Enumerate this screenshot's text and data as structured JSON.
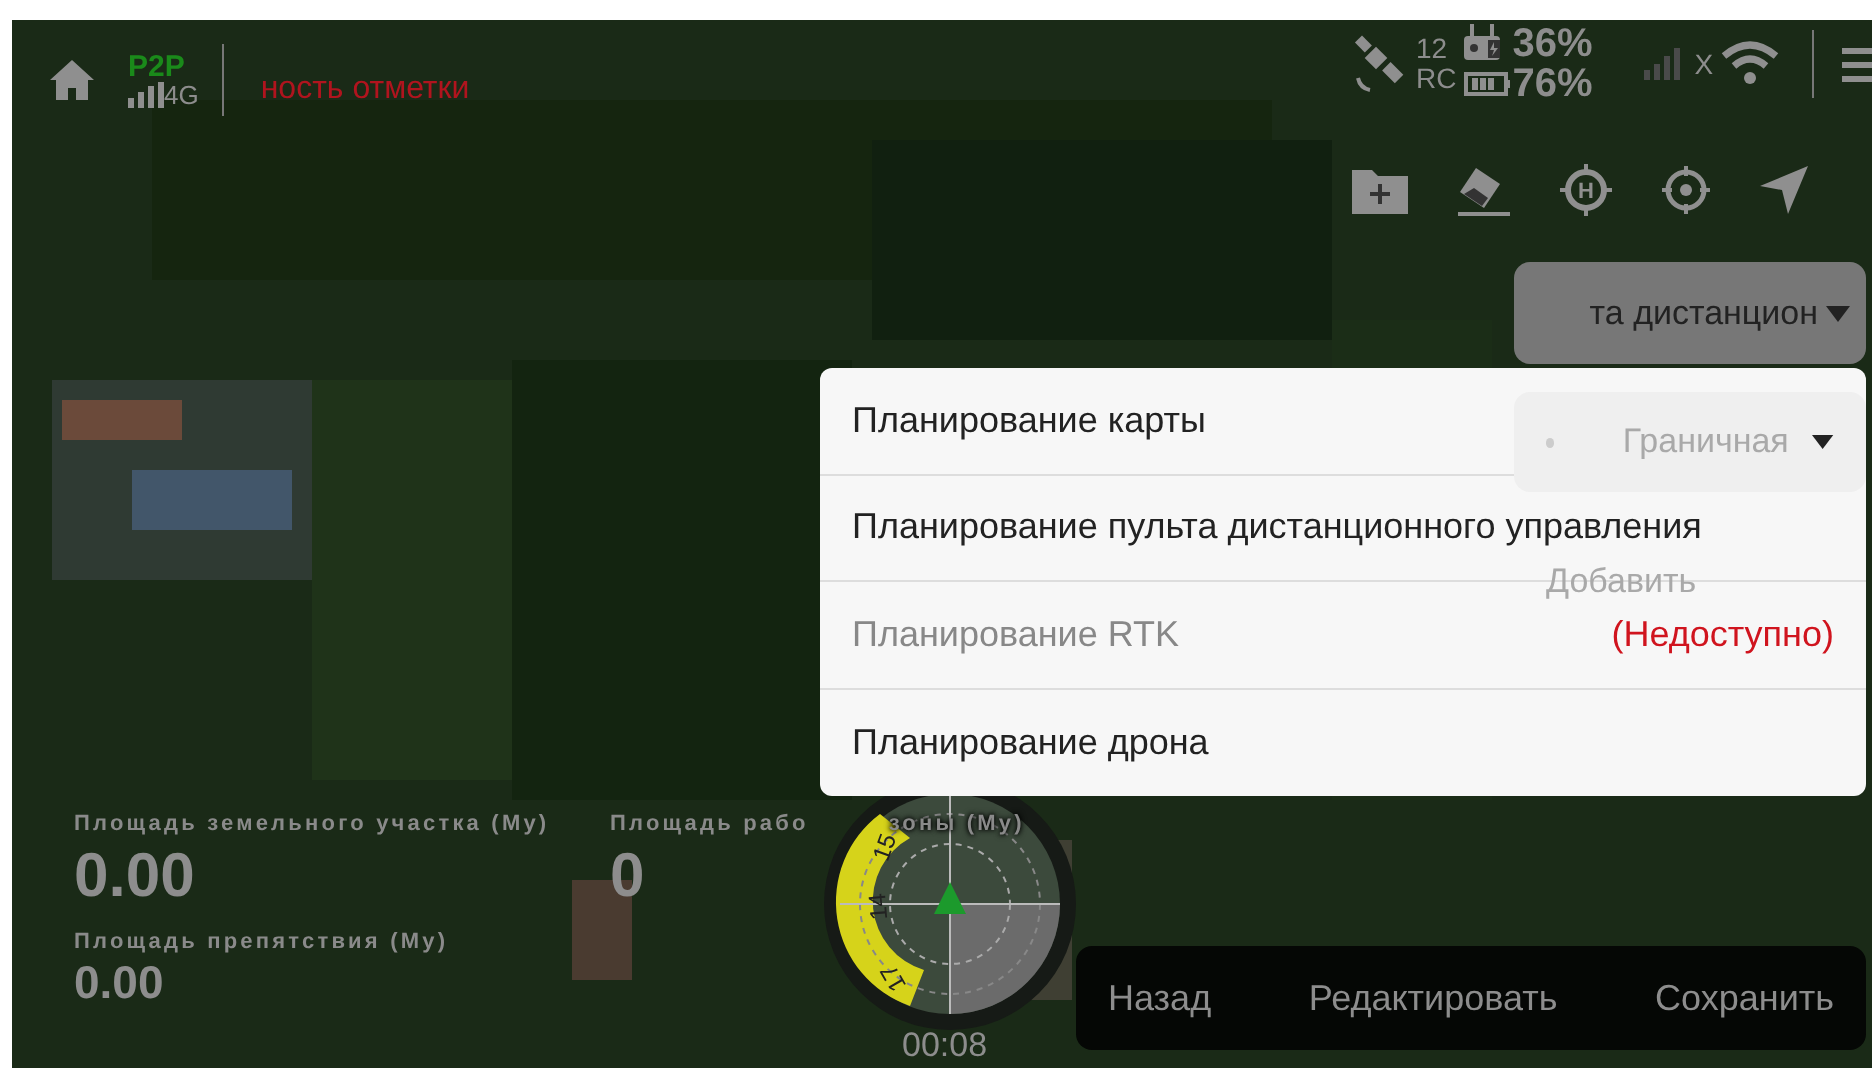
{
  "status_bar": {
    "connection": "P2P",
    "network": "4G",
    "mark_status": "ность отметки",
    "satellites": "12",
    "rc_label": "RC",
    "rc_battery": "36%",
    "drone_battery": "76%",
    "wifi_flag": "X"
  },
  "route_select": {
    "value": "та дистанцион"
  },
  "side_panel": {
    "boundary_select": "Граничная",
    "add_button": "Добавить"
  },
  "planning_menu": {
    "items": [
      {
        "label": "Планирование карты",
        "disabled": false
      },
      {
        "label": "Планирование пульта дистанционного управления",
        "disabled": false
      },
      {
        "label": "Планирование RTK",
        "disabled": true,
        "note": "(Недоступно)"
      },
      {
        "label": "Планирование дрона",
        "disabled": false
      }
    ]
  },
  "stats": [
    {
      "label": "Площадь земельного участка (Му)",
      "value": "0.00"
    },
    {
      "label": "Площадь рабо",
      "label_tail": "зоны (Му)",
      "value": "0"
    },
    {
      "label": "Площадь препятствия (Му)",
      "value": "0.00"
    }
  ],
  "toolbar": {
    "home_point_letter": "H"
  },
  "compass": {
    "ticks": [
      "15",
      "14",
      "17"
    ]
  },
  "timer": "00:08",
  "actions": [
    "Назад",
    "Редактировать",
    "Сохранить"
  ]
}
